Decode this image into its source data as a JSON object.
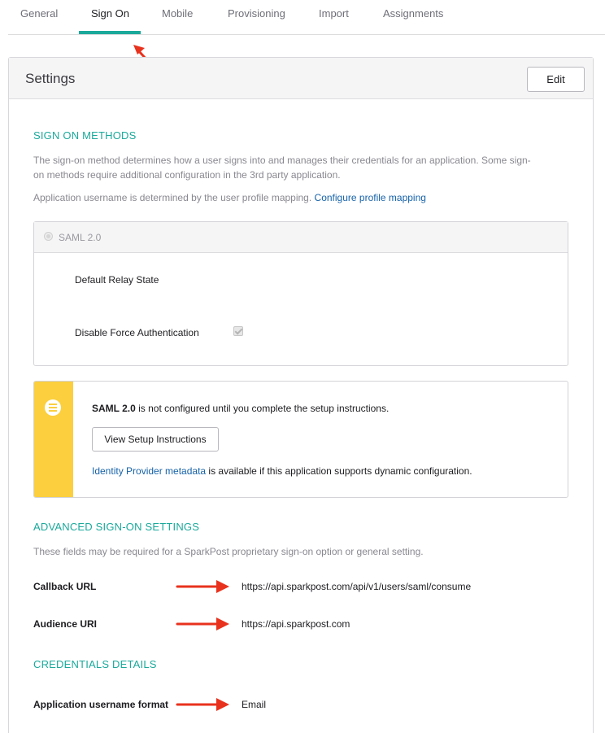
{
  "tabs": [
    {
      "label": "General"
    },
    {
      "label": "Sign On"
    },
    {
      "label": "Mobile"
    },
    {
      "label": "Provisioning"
    },
    {
      "label": "Import"
    },
    {
      "label": "Assignments"
    }
  ],
  "active_tab": "Sign On",
  "settings": {
    "title": "Settings",
    "edit_label": "Edit"
  },
  "sign_on_methods": {
    "title": "SIGN ON METHODS",
    "desc_line1": "The sign-on method determines how a user signs into and manages their credentials for an application. Some sign-",
    "desc_line2": "on methods require additional configuration in the 3rd party application.",
    "username_text": "Application username is determined by the user profile mapping.",
    "username_link": "Configure profile mapping"
  },
  "saml": {
    "label": "SAML 2.0",
    "relay_state_label": "Default Relay State",
    "force_auth_label": "Disable Force Authentication",
    "force_auth_checked": true
  },
  "notice": {
    "bold": "SAML 2.0",
    "text": " is not configured until you complete the setup instructions.",
    "button_label": "View Setup Instructions",
    "metadata_link": "Identity Provider metadata",
    "metadata_text": " is available if this application supports dynamic configuration.",
    "bar_color": "#fbcf3e"
  },
  "advanced": {
    "title": "ADVANCED SIGN-ON SETTINGS",
    "desc": "These fields may be required for a SparkPost proprietary sign-on option or general setting.",
    "callback_label": "Callback URL",
    "callback_value": "https://api.sparkpost.com/api/v1/users/saml/consume",
    "audience_label": "Audience URI",
    "audience_value": "https://api.sparkpost.com"
  },
  "credentials": {
    "title": "CREDENTIALS DETAILS",
    "format_label": "Application username format",
    "format_value": "Email"
  },
  "colors": {
    "accent": "#1aa99b",
    "link": "#1662a8",
    "annotation_arrow": "#e8321e"
  }
}
